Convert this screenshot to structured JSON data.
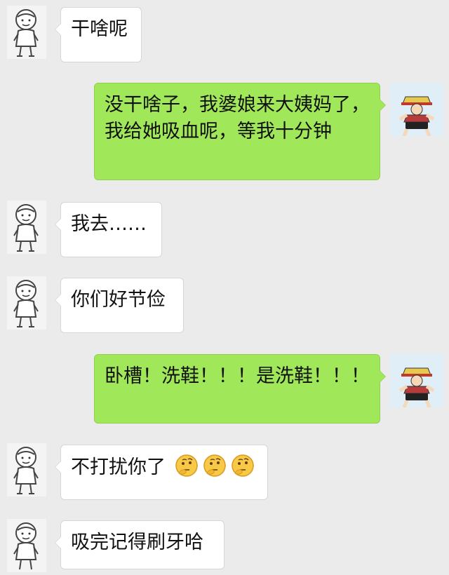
{
  "messages": [
    {
      "side": "in",
      "text": "干啥呢"
    },
    {
      "side": "out",
      "text": "没干啥子，我婆娘来大姨妈了，我给她吸血呢，等我十分钟"
    },
    {
      "side": "in",
      "text": "我去……"
    },
    {
      "side": "in",
      "text": "你们好节俭"
    },
    {
      "side": "out",
      "text": "卧槽！洗鞋！！！是洗鞋！！！"
    },
    {
      "side": "in",
      "text": "不打扰你了",
      "emoji": [
        "thinking-face-icon",
        "thinking-face-icon",
        "thinking-face-icon"
      ]
    },
    {
      "side": "in",
      "text": "吸完记得刷牙哈"
    }
  ],
  "colors": {
    "background": "#ebebeb",
    "incoming_bubble": "#ffffff",
    "outgoing_bubble": "#a0e75a"
  },
  "avatars": {
    "incoming": "cartoon-kid-sketch-avatar",
    "outgoing": "anime-character-avatar"
  }
}
